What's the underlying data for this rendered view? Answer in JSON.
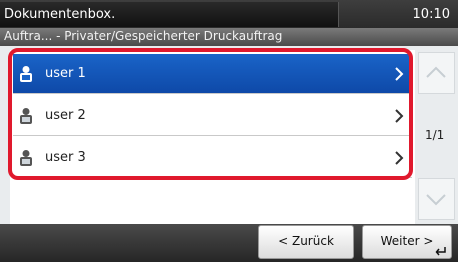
{
  "header": {
    "title": "Dokumentenbox.",
    "clock": "10:10",
    "subtitle": "Auftra... - Privater/Gespeicherter Druckauftrag"
  },
  "list": {
    "items": [
      {
        "label": "user 1",
        "icon": "user-icon",
        "selected": true
      },
      {
        "label": "user 2",
        "icon": "user-icon",
        "selected": false
      },
      {
        "label": "user 3",
        "icon": "user-icon",
        "selected": false
      }
    ]
  },
  "pagination": {
    "indicator": "1/1"
  },
  "footer": {
    "back_label": "< Zurück",
    "next_label": "Weiter >"
  },
  "colors": {
    "selection": "#1a64c8",
    "highlight_frame": "#e0192d"
  }
}
